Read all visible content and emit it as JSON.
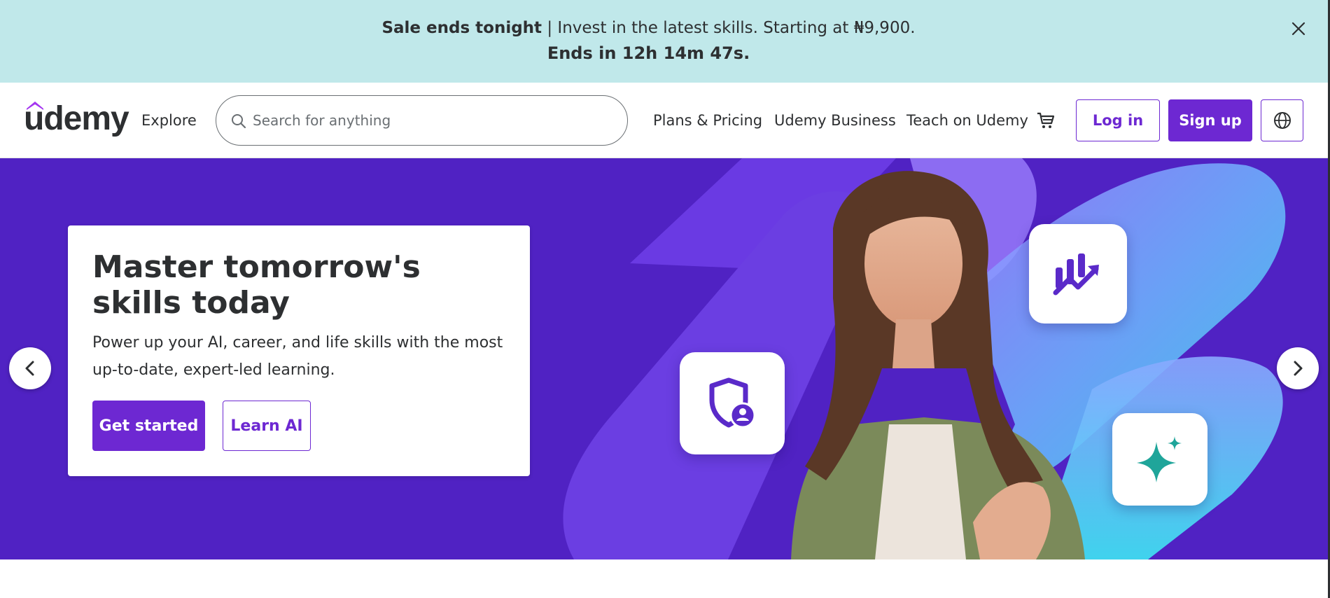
{
  "banner": {
    "sale_bold": "Sale ends tonight",
    "sale_text": " | Invest in the latest skills. Starting at ₦9,900.",
    "countdown": "Ends in 12h 14m 47s."
  },
  "header": {
    "logo_text": "udemy",
    "explore": "Explore",
    "search_placeholder": "Search for anything",
    "plans_pricing": "Plans & Pricing",
    "udemy_business": "Udemy Business",
    "teach": "Teach on Udemy",
    "login": "Log in",
    "signup": "Sign up"
  },
  "hero": {
    "title": "Master tomorrow's skills today",
    "subtitle": "Power up your AI, career, and life skills with the most up-to-date, expert-led learning.",
    "get_started": "Get started",
    "learn_ai": "Learn AI"
  },
  "colors": {
    "brand_purple": "#6d28d2",
    "hero_background": "#5022c3",
    "banner_background": "#c0e8ea",
    "accent_teal": "#1fa59a"
  },
  "icons": [
    "close-icon",
    "search-icon",
    "cart-icon",
    "globe-icon",
    "chevron-left-icon",
    "chevron-right-icon",
    "chart-growth-icon",
    "shield-user-icon",
    "sparkle-icon"
  ]
}
